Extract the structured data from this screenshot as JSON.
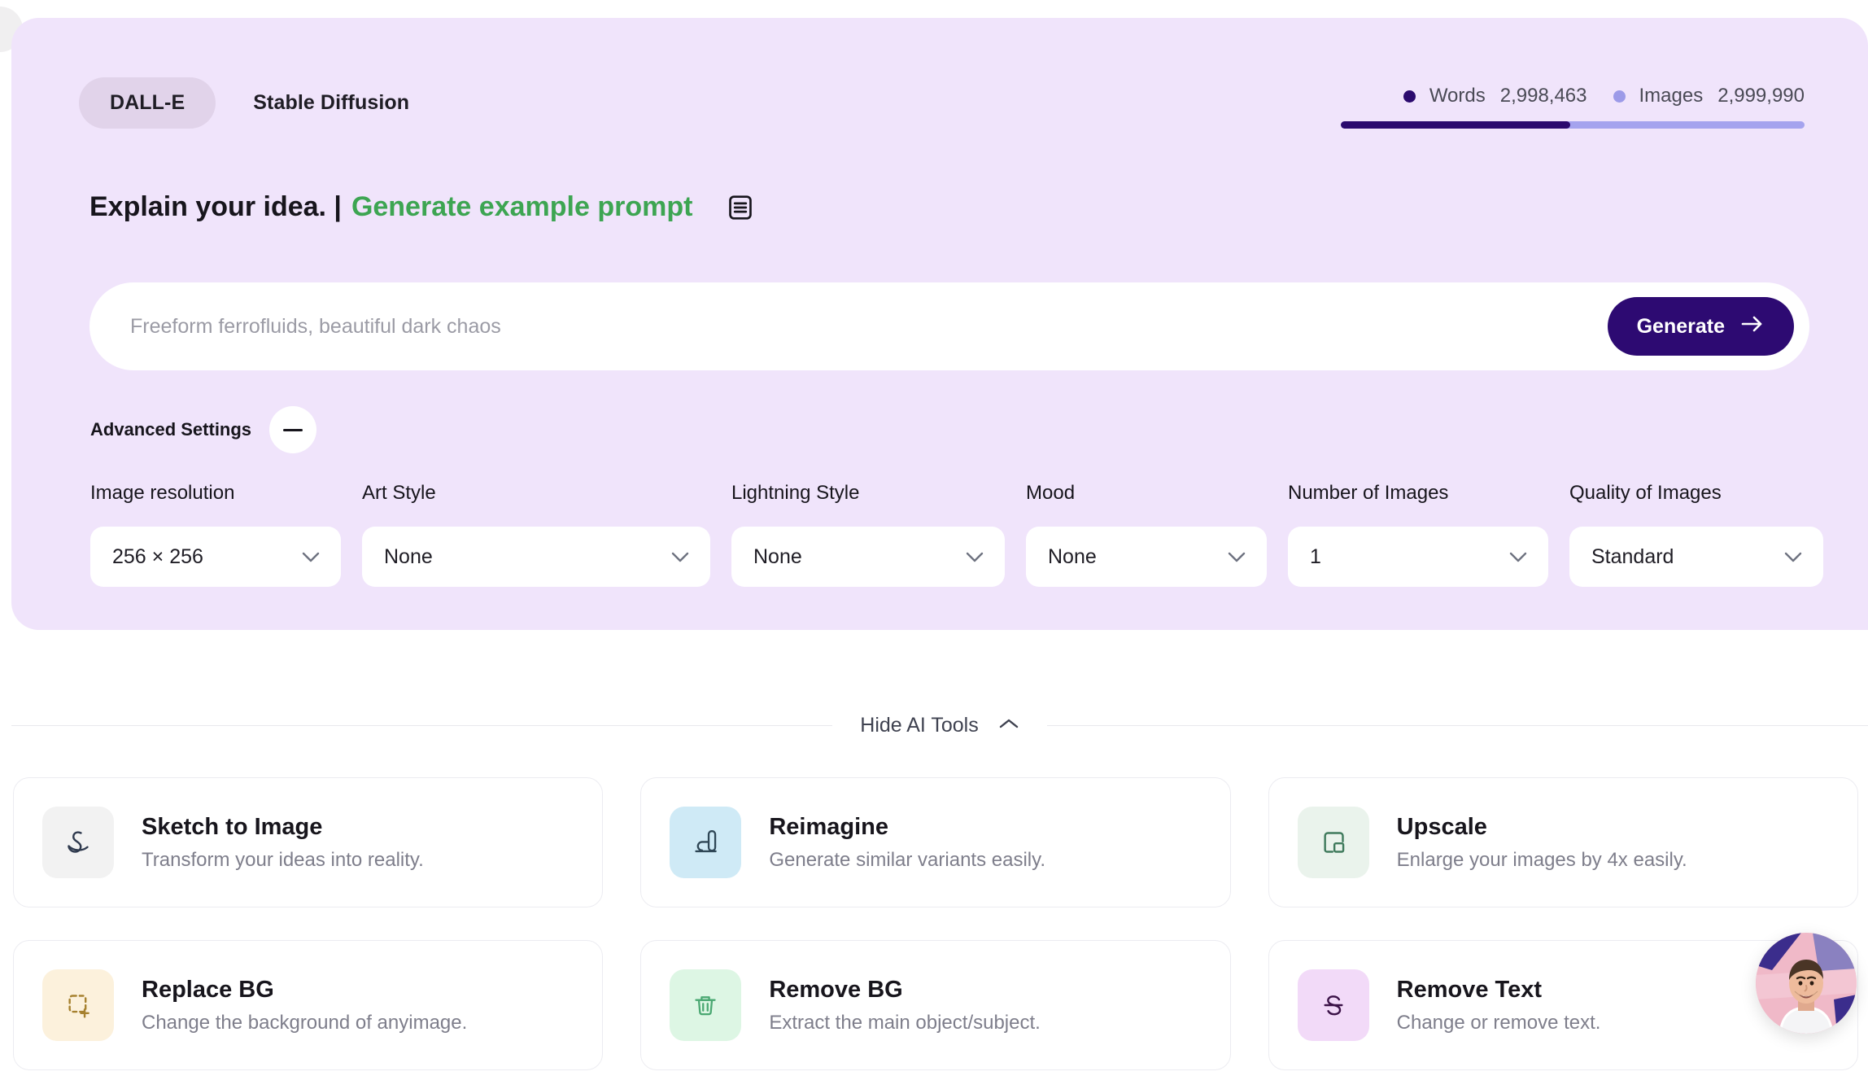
{
  "model_tabs": [
    {
      "label": "DALL-E",
      "active": true
    },
    {
      "label": "Stable Diffusion",
      "active": false
    }
  ],
  "usage": {
    "words_label": "Words",
    "words_value": "2,998,463",
    "images_label": "Images",
    "images_value": "2,999,990",
    "words_color": "#2b0a6e",
    "images_color": "#9c9ae8",
    "bar_fill_percent": 49.5
  },
  "headline": {
    "static_text": "Explain your idea. |",
    "link_text": "Generate example prompt",
    "link_color": "#3da552",
    "icon": "prompt-list-icon"
  },
  "prompt": {
    "placeholder": "Freeform ferrofluids, beautiful dark chaos",
    "value": "",
    "generate_label": "Generate",
    "generate_color": "#2d0a72"
  },
  "advanced": {
    "label": "Advanced Settings",
    "toggle_state": "expanded",
    "toggle_icon": "minus-icon"
  },
  "settings": [
    {
      "label": "Image resolution",
      "value": "256 × 256",
      "width_class": "w-res"
    },
    {
      "label": "Art Style",
      "value": "None",
      "width_class": "w-art"
    },
    {
      "label": "Lightning Style",
      "value": "None",
      "width_class": "w-lit"
    },
    {
      "label": "Mood",
      "value": "None",
      "width_class": "w-mood"
    },
    {
      "label": "Number of Images",
      "value": "1",
      "width_class": "w-num"
    },
    {
      "label": "Quality of Images",
      "value": "Standard",
      "width_class": "w-qual"
    }
  ],
  "tools_section": {
    "toggle_label": "Hide AI Tools",
    "toggle_icon": "chevron-up-icon"
  },
  "tools": [
    {
      "title": "Sketch to Image",
      "desc": "Transform your ideas into reality.",
      "icon": "scribble-icon",
      "tile_color": "#f2f2f2",
      "stroke_color": "#2f3a4e"
    },
    {
      "title": "Reimagine",
      "desc": "Generate similar variants easily.",
      "icon": "pen-tool-icon",
      "tile_color": "#cfeaf6",
      "stroke_color": "#2f4756"
    },
    {
      "title": "Upscale",
      "desc": "Enlarge your images by 4x easily.",
      "icon": "upscale-frames-icon",
      "tile_color": "#eaf3ec",
      "stroke_color": "#3f7a5c"
    },
    {
      "title": "Replace BG",
      "desc": "Change the background of anyimage.",
      "icon": "dashed-box-plus-icon",
      "tile_color": "#fcf1dc",
      "stroke_color": "#a6812f"
    },
    {
      "title": "Remove BG",
      "desc": "Extract the main object/subject.",
      "icon": "trash-icon",
      "tile_color": "#ddf6e4",
      "stroke_color": "#4aa872"
    },
    {
      "title": "Remove Text",
      "desc": "Change or remove text.",
      "icon": "strikethrough-s-icon",
      "tile_color": "#f2daf8",
      "stroke_color": "#3b1247"
    }
  ],
  "support": {
    "avatar": "support-agent-avatar"
  }
}
